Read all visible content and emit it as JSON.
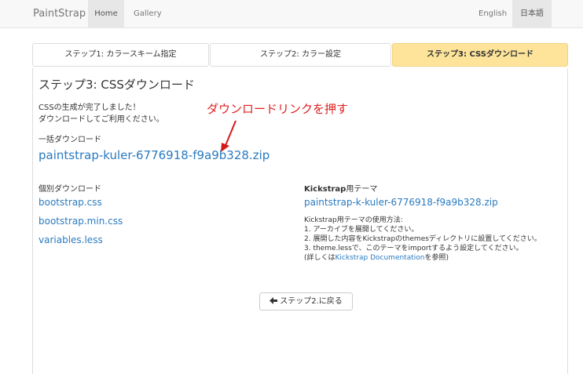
{
  "navbar": {
    "brand": "PaintStrap",
    "home": "Home",
    "gallery": "Gallery",
    "lang_en": "English",
    "lang_ja": "日本語"
  },
  "tabs": [
    {
      "label": "ステップ1: カラースキーム指定"
    },
    {
      "label": "ステップ2: カラー設定"
    },
    {
      "label": "ステップ3: CSSダウンロード"
    }
  ],
  "main": {
    "title": "ステップ3: CSSダウンロード",
    "done_line1": "CSSの生成が完了しました！",
    "done_line2": "ダウンロードしてご利用ください。",
    "annotation": "ダウンロードリンクを押す",
    "bulk_label": "一括ダウンロード",
    "bulk_zip": "paintstrap-kuler-6776918-f9a9b328.zip",
    "individual_label": "個別ダウンロード",
    "files": [
      "bootstrap.css",
      "bootstrap.min.css",
      "variables.less"
    ],
    "kickstrap_label_bold": "Kickstrap",
    "kickstrap_label_rest": "用テーマ",
    "kickstrap_zip": "paintstrap-k-kuler-6776918-f9a9b328.zip",
    "usage_title": "Kickstrap用テーマの使用方法:",
    "usage_1": "1. アーカイブを展開してください。",
    "usage_2": "2. 展開した内容をKickstrapのthemesディレクトリに設置してください。",
    "usage_3": "3. theme.lessで、このテーマをimportするよう設定してください。",
    "usage_4_pre": "(詳しくは",
    "usage_4_link": "Kickstrap Documentation",
    "usage_4_post": "を参照)",
    "back_button": "ステップ2.に戻る",
    "back_icon": "arrow-left-icon"
  },
  "colors": {
    "link": "#2a7ac0",
    "active_tab": "#fde49a",
    "annotation": "#e02020"
  }
}
